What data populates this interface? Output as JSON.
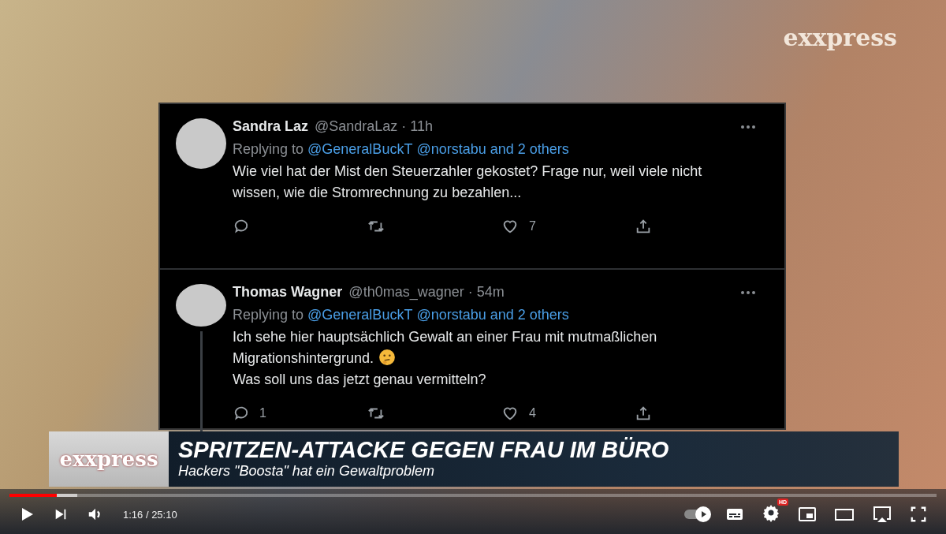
{
  "channel_logo": "exxpress",
  "tweets": [
    {
      "name": "Sandra Laz",
      "handle": "@SandraLaz · 11h",
      "replying_label": "Replying to",
      "replying_links": [
        "@GeneralBuckT",
        "@norstabu and 2 others"
      ],
      "body": [
        {
          "text": "Wie viel hat der Mist den Steuerzahler gekostet? Frage nur, weil viele nicht wissen, wie die Stromrechnung zu bezahlen...",
          "emoji": false
        }
      ],
      "likes": "7",
      "thread": false
    },
    {
      "name": "Thomas Wagner",
      "handle": "@th0mas_wagner · 54m",
      "replying_label": "Replying to",
      "replying_links": [
        "@GeneralBuckT",
        "@norstabu and 2 others"
      ],
      "body": [
        {
          "text": "Ich sehe hier hauptsächlich Gewalt an einer Frau mit mutmaßlichen Migrationshintergrund.",
          "emoji": true
        },
        {
          "text": "Was soll uns das jetzt genau vermitteln?",
          "emoji": false
        }
      ],
      "replies": "1",
      "likes": "4",
      "thread": true
    }
  ],
  "lower_third": {
    "logo": "exxpress",
    "headline": "SPRITZEN-ATTACKE GEGEN FRAU IM BÜRO",
    "subline": "Hackers \"Boosta\" hat ein Gewaltproblem"
  },
  "player": {
    "progress": {
      "level": 0.051
    },
    "buffered": {
      "level": 0.073
    },
    "time": "1:16 / 25:10",
    "autoplay": {
      "on": true
    },
    "quality_badge": "HD"
  }
}
